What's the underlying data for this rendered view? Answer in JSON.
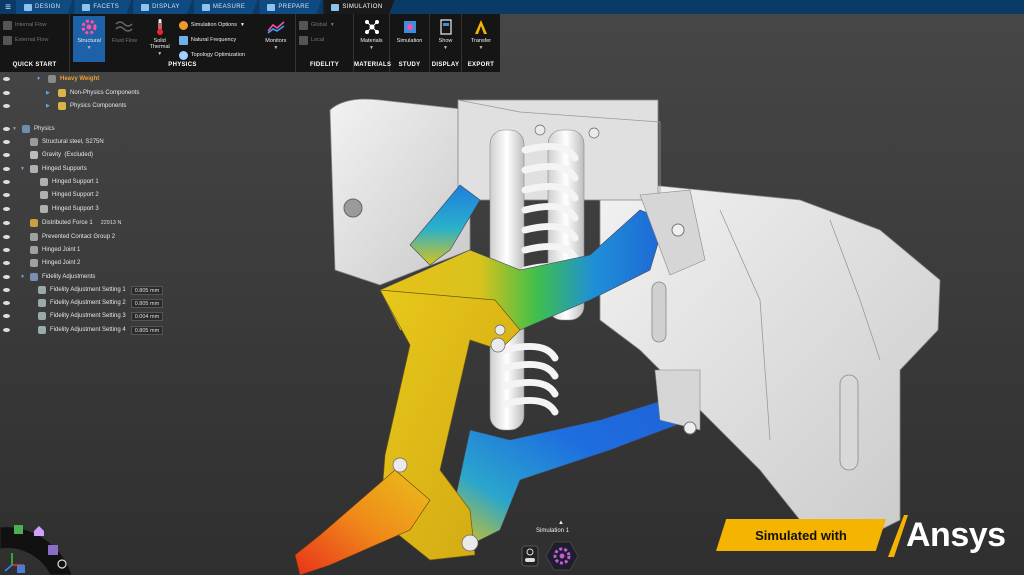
{
  "tabs": [
    {
      "label": "DESIGN",
      "active": false
    },
    {
      "label": "FACETS",
      "active": false
    },
    {
      "label": "DISPLAY",
      "active": false
    },
    {
      "label": "MEASURE",
      "active": false
    },
    {
      "label": "PREPARE",
      "active": false
    },
    {
      "label": "SIMULATION",
      "active": true
    }
  ],
  "ribbon": {
    "quick_start": {
      "label": "QUICK START",
      "internal_flow": "Internal Flow",
      "external_flow": "External Flow"
    },
    "physics": {
      "label": "PHYSICS",
      "structural": "Structural",
      "fluid_flow": "Fluid Flow",
      "solid_thermal": "Solid Thermal",
      "simulation_options": "Simulation Options",
      "natural_frequency": "Natural Frequency",
      "topology_optimization": "Topology Optimization",
      "monitors": "Monitors"
    },
    "fidelity": {
      "label": "FIDELITY",
      "global": "Global",
      "local": "Local"
    },
    "materials": {
      "label": "MATERIALS",
      "button": "Materials"
    },
    "study": {
      "label": "STUDY",
      "button": "Simulation"
    },
    "display": {
      "label": "DISPLAY",
      "button": "Show"
    },
    "export": {
      "label": "EXPORT",
      "button": "Transfer"
    }
  },
  "tree": {
    "root": "Heavy Weight",
    "non_physics": "Non-Physics Components",
    "physics_components": "Physics Components",
    "physics": "Physics",
    "material": "Structural steel, S275N",
    "gravity": "Gravity",
    "gravity_state": "(Excluded)",
    "hinged_supports": "Hinged Supports",
    "hinged_support_1": "Hinged Support 1",
    "hinged_support_2": "Hinged Support 2",
    "hinged_support_3": "Hinged Support 3",
    "distributed_force": "Distributed Force 1",
    "distributed_force_value": "22913 N",
    "prevented_contact": "Prevented Contact Group 2",
    "hinged_joint_1": "Hinged Joint 1",
    "hinged_joint_2": "Hinged Joint 2",
    "fidelity_adjustments": "Fidelity Adjustments",
    "fidelity_settings": [
      {
        "label": "Fidelity Adjustment Setting 1",
        "value": "0.805 mm"
      },
      {
        "label": "Fidelity Adjustment Setting 2",
        "value": "0.805 mm"
      },
      {
        "label": "Fidelity Adjustment Setting 3",
        "value": "0.004 mm"
      },
      {
        "label": "Fidelity Adjustment Setting 4",
        "value": "0.805 mm"
      }
    ]
  },
  "sim_bar": {
    "label": "Simulation 1"
  },
  "brand": {
    "tagline": "Simulated with",
    "name": "Ansys"
  },
  "colors": {
    "tabbar": "#0a3a66",
    "ribbon": "#151515",
    "selected": "#1d62a8",
    "tree_title": "#f0a030",
    "brand_yellow": "#f5b400"
  }
}
